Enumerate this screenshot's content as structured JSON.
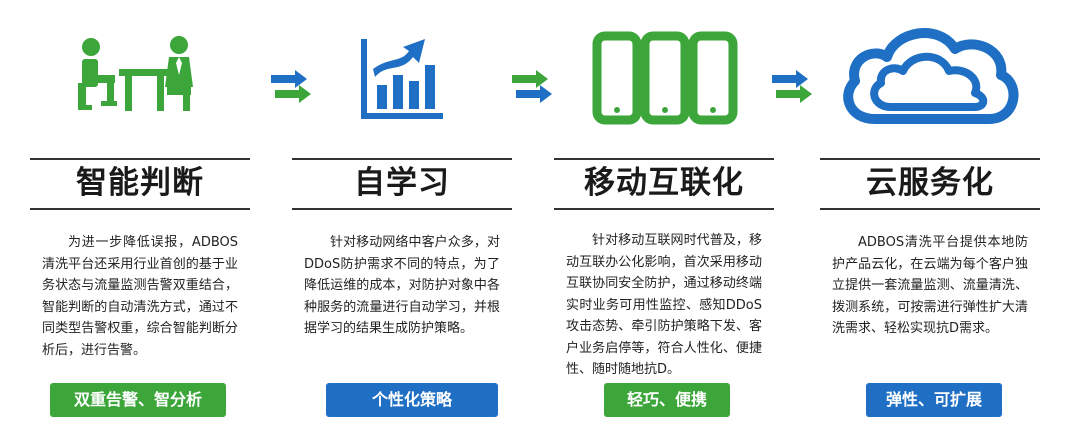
{
  "colors": {
    "green": "#3ca63b",
    "blue": "#1f6fc4",
    "text": "#222222"
  },
  "features": [
    {
      "icon": "meeting-people-icon",
      "title": "智能判断",
      "desc": "为进一步降低误报，ADBOS清洗平台还采用行业首创的基于业务状态与流量监测告警双重结合，智能判断的自动清洗方式，通过不同类型告警权重，综合智能判断分析后，进行告警。",
      "badge": "双重告警、智分析",
      "badge_color": "green"
    },
    {
      "icon": "growth-chart-icon",
      "title": "自学习",
      "desc": "针对移动网络中客户众多，对DDoS防护需求不同的特点，为了降低运维的成本，对防护对象中各种服务的流量进行自动学习，并根据学习的结果生成防护策略。",
      "badge": "个性化策略",
      "badge_color": "blue"
    },
    {
      "icon": "mobile-devices-icon",
      "title": "移动互联化",
      "desc": "针对移动互联网时代普及，移动互联办公化影响，首次采用移动互联协同安全防护，通过移动终端实时业务可用性监控、感知DDoS攻击态势、牵引防护策略下发、客户业务启停等，符合人性化、便捷性、随时随地抗D。",
      "badge": "轻巧、便携",
      "badge_color": "green"
    },
    {
      "icon": "cloud-icon",
      "title": "云服务化",
      "desc": "ADBOS清洗平台提供本地防护产品云化，在云端为每个客户独立提供一套流量监测、流量清洗、拨测系统，可按需进行弹性扩大清洗需求、轻松实现抗D需求。",
      "badge": "弹性、可扩展",
      "badge_color": "blue"
    }
  ]
}
